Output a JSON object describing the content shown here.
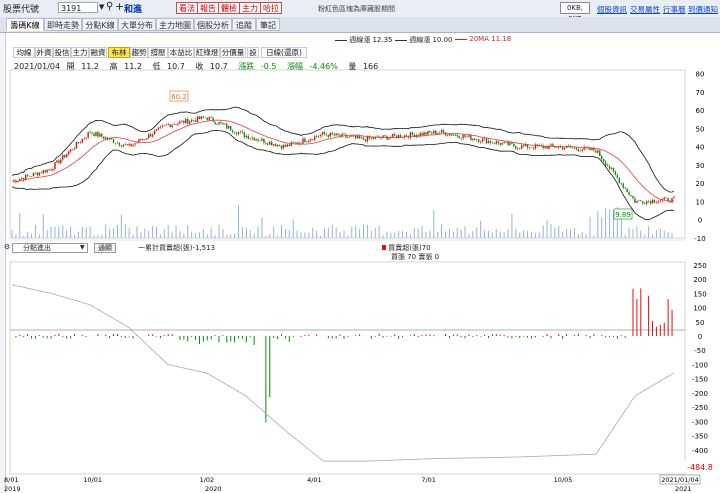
{
  "topbar": {
    "label": "股票代號",
    "stock_code": "3191",
    "stock_name": "和進",
    "tags": [
      "看法",
      "報告",
      "體檢",
      "主力",
      "哈拉"
    ],
    "notice": "粉紅色區塊為庫藏股期間",
    "ok_label": "0KB, 0KB",
    "links": [
      "個股資訊",
      "交易屬性",
      "行事曆",
      "到價通知"
    ]
  },
  "tabs": [
    "籌碼K線",
    "即時走勢",
    "分點K線",
    "大單分布",
    "主力地圖",
    "個股分析",
    "追蹤",
    "筆記"
  ],
  "legend": {
    "ma1": "週線漲 12.35",
    "ma2": "週線漲 10.00",
    "ma3": "20MA 11.18"
  },
  "toolbar": [
    "均線",
    "外資",
    "投信",
    "主力",
    "融資",
    "布林",
    "趨勢",
    "撐壓",
    "本益比",
    "紅綠燈",
    "分價量",
    "設",
    "日線(還原)"
  ],
  "info": {
    "date": "2021/01/04",
    "open_label": "開",
    "open": "11.2",
    "high_label": "高",
    "high": "11.2",
    "low_label": "低",
    "low": "10.7",
    "close_label": "收",
    "close": "10.7",
    "chg_label": "漲跌",
    "chg": "-0.5",
    "pct_label": "漲幅",
    "pct": "-4.46%",
    "vol_label": "量",
    "vol": "166"
  },
  "sub": {
    "select": "分點進出",
    "button": "通顯",
    "cum_label": "一累計買賣超(張)-1,513",
    "buy_label": "買賣超(張)70",
    "detail": "買張 70 賣張 0"
  },
  "price_axis": [
    "80",
    "70",
    "60",
    "50",
    "40",
    "30",
    "20",
    "10",
    "0",
    "-10"
  ],
  "sub_axis": [
    "250",
    "200",
    "150",
    "100",
    "50",
    "0",
    "-50",
    "-100",
    "-150",
    "-200",
    "-250",
    "-300",
    "-350",
    "-400",
    "-450"
  ],
  "sub_last": "-484.8",
  "date_axis": [
    "8/01",
    "10/01",
    "1/02",
    "4/01",
    "7/01",
    "10/05"
  ],
  "year_labels": [
    "2019",
    "2020",
    "2021"
  ],
  "date_current": "2021/01/04",
  "annotations": {
    "high": "60.2",
    "low": "9.89"
  },
  "colors": {
    "up": "#e01010",
    "down": "#0a8a0a",
    "ma": "#e04040",
    "band": "#111111",
    "cum": "#aaaaaa"
  },
  "chart_data": {
    "type": "line",
    "price": {
      "x": [
        "2019-08-01",
        "2019-09-01",
        "2019-10-01",
        "2019-11-01",
        "2019-12-01",
        "2020-01-02",
        "2020-02-01",
        "2020-03-01",
        "2020-04-01",
        "2020-05-01",
        "2020-06-01",
        "2020-07-01",
        "2020-08-01",
        "2020-09-01",
        "2020-10-05",
        "2020-11-01",
        "2020-12-01",
        "2021-01-04"
      ],
      "close": [
        21,
        28,
        48,
        40,
        52,
        56,
        46,
        40,
        47,
        44,
        46,
        48,
        44,
        40,
        40,
        38,
        10,
        11
      ],
      "ylim": [
        -10,
        82
      ]
    },
    "sub": {
      "cum": [
        180,
        150,
        110,
        30,
        -100,
        -130,
        -210,
        -330,
        -440,
        -440,
        -435,
        -430,
        -428,
        -425,
        -420,
        -415,
        -210,
        -130
      ],
      "ylim": [
        -484.8,
        260
      ]
    }
  }
}
